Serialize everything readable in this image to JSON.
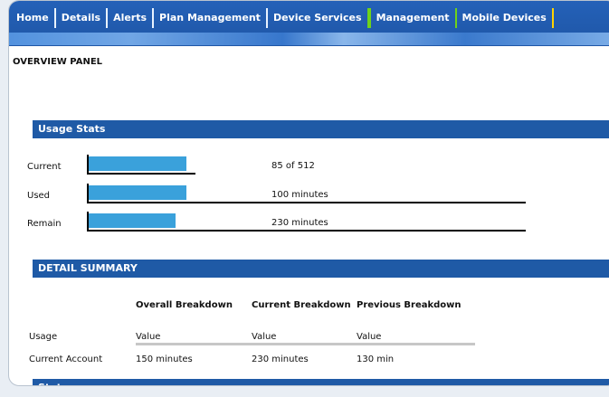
{
  "nav": {
    "tabs": [
      {
        "label": "Home"
      },
      {
        "label": "Details"
      },
      {
        "label": "Alerts"
      },
      {
        "label": "Plan Management"
      },
      {
        "label": "Device Services"
      },
      {
        "label": "Management"
      },
      {
        "label": "Mobile Devices"
      }
    ]
  },
  "breadcrumb": "OVERVIEW PANEL",
  "sections": {
    "usage": "Usage Stats",
    "details": "DETAIL SUMMARY",
    "bottom": "Status"
  },
  "usage_rows": [
    {
      "label": "Current",
      "value": "85 of 512",
      "fill": 0.4
    },
    {
      "label": "Used",
      "value": "100 minutes",
      "fill": 0.35
    },
    {
      "label": "Remain",
      "value": "230 minutes",
      "fill": 0.33
    }
  ],
  "table": {
    "headers": [
      "Overall Breakdown",
      "Current Breakdown",
      "Previous Breakdown"
    ],
    "rows": [
      {
        "label": "Usage",
        "cells": [
          "Value",
          "Value",
          "Value"
        ]
      },
      {
        "label": "Current Account",
        "cells": [
          "150 minutes",
          "230 minutes",
          "130 min"
        ]
      }
    ]
  }
}
